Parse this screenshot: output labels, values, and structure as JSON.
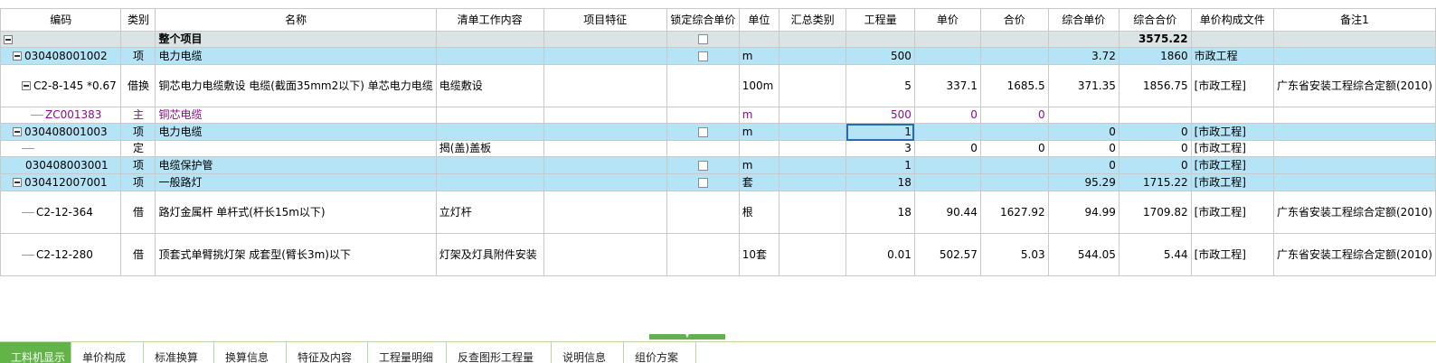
{
  "columns": [
    "编码",
    "类别",
    "名称",
    "清单工作内容",
    "项目特征",
    "锁定综合单价",
    "单位",
    "汇总类别",
    "工程量",
    "单价",
    "合价",
    "综合单价",
    "综合合价",
    "单价构成文件",
    "备注1"
  ],
  "rows": [
    {
      "code": "",
      "type": "",
      "name": "整个项目",
      "content": "",
      "feature": "",
      "lock": true,
      "unit": "",
      "sum_cat": "",
      "qty": "",
      "price": "",
      "total": "",
      "comp_price": "",
      "comp_total": "3575.22",
      "file": "",
      "note": ""
    },
    {
      "code": "030408001002",
      "type": "项",
      "name": "电力电缆",
      "content": "",
      "feature": "",
      "lock": true,
      "unit": "m",
      "sum_cat": "",
      "qty": "500",
      "price": "",
      "total": "",
      "comp_price": "3.72",
      "comp_total": "1860",
      "file": "市政工程",
      "note": ""
    },
    {
      "code": "C2-8-145 *0.67",
      "type": "借换",
      "name": "铜芯电力电缆敷设 电缆(截面35mm2以下) 单芯电力电缆",
      "content": "电缆敷设",
      "feature": "",
      "lock": false,
      "unit": "100m",
      "sum_cat": "",
      "qty": "5",
      "price": "337.1",
      "total": "1685.5",
      "comp_price": "371.35",
      "comp_total": "1856.75",
      "file": "[市政工程]",
      "note": "广东省安装工程综合定额(2010)"
    },
    {
      "code": "ZC001383",
      "type": "主",
      "name": "铜芯电缆",
      "content": "",
      "feature": "",
      "lock": false,
      "unit": "m",
      "sum_cat": "",
      "qty": "500",
      "price": "0",
      "total": "0",
      "comp_price": "",
      "comp_total": "",
      "file": "",
      "note": ""
    },
    {
      "code": "030408001003",
      "type": "项",
      "name": "电力电缆",
      "content": "",
      "feature": "",
      "lock": true,
      "unit": "m",
      "sum_cat": "",
      "qty": "1",
      "price": "",
      "total": "",
      "comp_price": "0",
      "comp_total": "0",
      "file": "[市政工程]",
      "note": ""
    },
    {
      "code": "",
      "type": "定",
      "name": "",
      "content": "揭(盖)盖板",
      "feature": "",
      "lock": false,
      "unit": "",
      "sum_cat": "",
      "qty": "3",
      "price": "0",
      "total": "0",
      "comp_price": "0",
      "comp_total": "0",
      "file": "[市政工程]",
      "note": ""
    },
    {
      "code": "030408003001",
      "type": "项",
      "name": "电缆保护管",
      "content": "",
      "feature": "",
      "lock": true,
      "unit": "m",
      "sum_cat": "",
      "qty": "1",
      "price": "",
      "total": "",
      "comp_price": "0",
      "comp_total": "0",
      "file": "[市政工程]",
      "note": ""
    },
    {
      "code": "030412007001",
      "type": "项",
      "name": "一般路灯",
      "content": "",
      "feature": "",
      "lock": true,
      "unit": "套",
      "sum_cat": "",
      "qty": "18",
      "price": "",
      "total": "",
      "comp_price": "95.29",
      "comp_total": "1715.22",
      "file": "[市政工程]",
      "note": ""
    },
    {
      "code": "C2-12-364",
      "type": "借",
      "name": "路灯金属杆 单杆式(杆长15m以下)",
      "content": "立灯杆",
      "feature": "",
      "lock": false,
      "unit": "根",
      "sum_cat": "",
      "qty": "18",
      "price": "90.44",
      "total": "1627.92",
      "comp_price": "94.99",
      "comp_total": "1709.82",
      "file": "[市政工程]",
      "note": "广东省安装工程综合定额(2010)"
    },
    {
      "code": "C2-12-280",
      "type": "借",
      "name": "顶套式单臂挑灯架 成套型(臂长3m)以下",
      "content": "灯架及灯具附件安装",
      "feature": "",
      "lock": false,
      "unit": "10套",
      "sum_cat": "",
      "qty": "0.01",
      "price": "502.57",
      "total": "5.03",
      "comp_price": "544.05",
      "comp_total": "5.44",
      "file": "[市政工程]",
      "note": "广东省安装工程综合定额(2010)"
    }
  ],
  "tabs": [
    "工料机显示",
    "单价构成",
    "标准换算",
    "换算信息",
    "特征及内容",
    "工程量明细",
    "反查图形工程量",
    "说明信息",
    "组价方案"
  ],
  "active_tab": "工料机显示",
  "colors": {
    "cyan_row": "#b4e4f6",
    "head_row": "#dbe4e4",
    "accent_green": "#62b449",
    "highlight_header": "#fdf2c4",
    "main_material_text": "#8a0f8a"
  }
}
